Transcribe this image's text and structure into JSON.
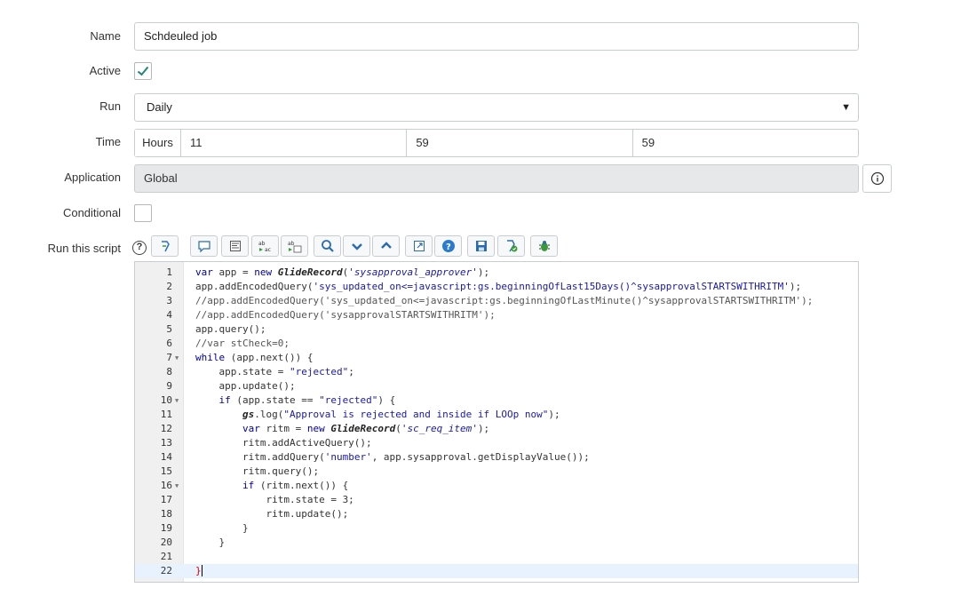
{
  "form": {
    "name_label": "Name",
    "name_value": "Schdeuled job",
    "active_label": "Active",
    "run_label": "Run",
    "run_value": "Daily",
    "time_label": "Time",
    "time_unit": "Hours",
    "time_hours": "11",
    "time_minutes": "59",
    "time_seconds": "59",
    "application_label": "Application",
    "application_value": "Global",
    "conditional_label": "Conditional",
    "script_label": "Run this script"
  },
  "toolbar_icons": [
    "script-sync-icon",
    "comment-icon",
    "format-icon",
    "replace-icon",
    "replace-all-icon",
    "search-icon",
    "find-next-icon",
    "find-previous-icon",
    "fullscreen-icon",
    "help-icon",
    "save-icon",
    "check-syntax-icon",
    "debug-icon"
  ],
  "script_lines": [
    {
      "n": "1",
      "t": "var app = new GlideRecord('sysapproval_approver');"
    },
    {
      "n": "2",
      "t": "app.addEncodedQuery('sys_updated_on<=javascript:gs.beginningOfLast15Days()^sysapprovalSTARTSWITHRITM');"
    },
    {
      "n": "3",
      "t": "//app.addEncodedQuery('sys_updated_on<=javascript:gs.beginningOfLastMinute()^sysapprovalSTARTSWITHRITM');"
    },
    {
      "n": "4",
      "t": "//app.addEncodedQuery('sysapprovalSTARTSWITHRITM');"
    },
    {
      "n": "5",
      "t": "app.query();"
    },
    {
      "n": "6",
      "t": "//var stCheck=0;"
    },
    {
      "n": "7",
      "t": "while (app.next()) {"
    },
    {
      "n": "8",
      "t": "    app.state = \"rejected\";"
    },
    {
      "n": "9",
      "t": "    app.update();"
    },
    {
      "n": "10",
      "t": "    if (app.state == \"rejected\") {"
    },
    {
      "n": "11",
      "t": "        gs.log(\"Approval is rejected and inside if LOOp now\");"
    },
    {
      "n": "12",
      "t": "        var ritm = new GlideRecord('sc_req_item');"
    },
    {
      "n": "13",
      "t": "        ritm.addActiveQuery();"
    },
    {
      "n": "14",
      "t": "        ritm.addQuery('number', app.sysapproval.getDisplayValue());"
    },
    {
      "n": "15",
      "t": "        ritm.query();"
    },
    {
      "n": "16",
      "t": "        if (ritm.next()) {"
    },
    {
      "n": "17",
      "t": "            ritm.state = 3;"
    },
    {
      "n": "18",
      "t": "            ritm.update();"
    },
    {
      "n": "19",
      "t": "        }"
    },
    {
      "n": "20",
      "t": "    }"
    },
    {
      "n": "21",
      "t": ""
    },
    {
      "n": "22",
      "t": "}"
    }
  ]
}
